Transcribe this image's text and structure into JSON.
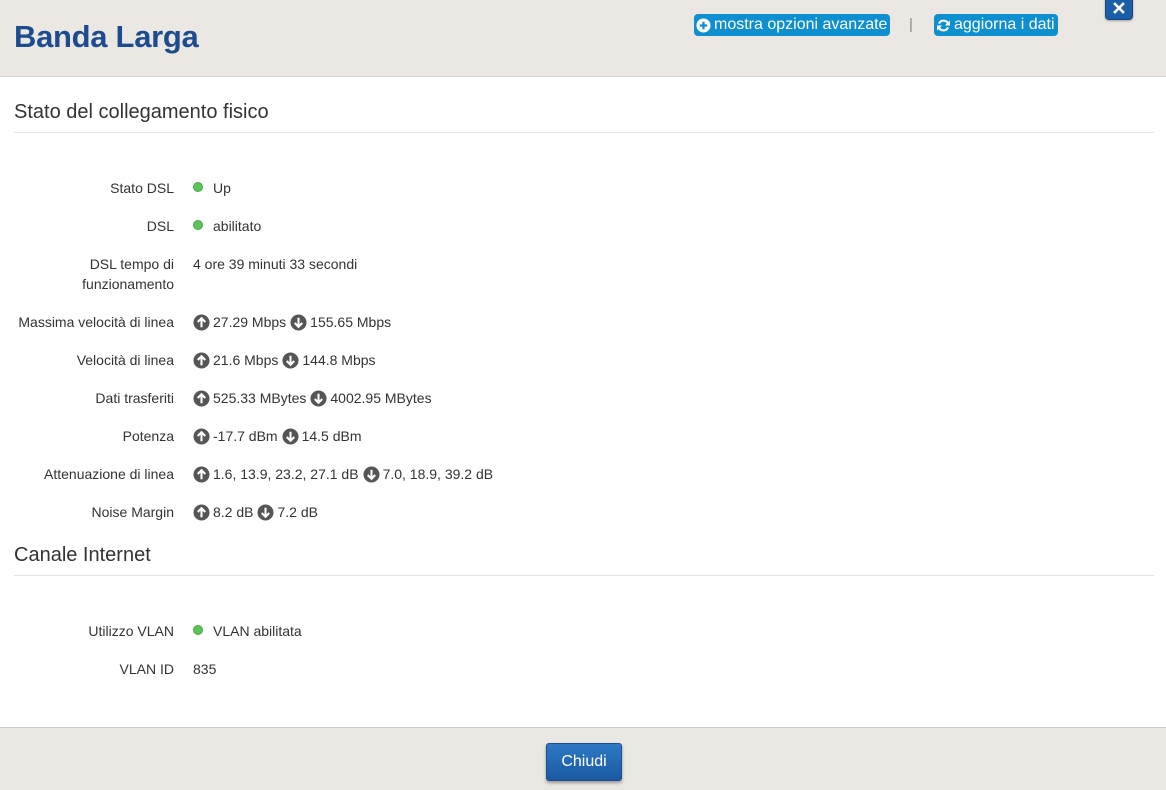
{
  "header": {
    "title": "Banda Larga",
    "advanced_link": "mostra opzioni avanzate",
    "separator": "|",
    "refresh_link": "aggiorna i dati"
  },
  "sections": {
    "physical": {
      "title": "Stato del collegamento fisico"
    },
    "internet": {
      "title": "Canale Internet"
    }
  },
  "rows": {
    "dsl_state": {
      "label": "Stato DSL",
      "value": "Up"
    },
    "dsl": {
      "label": "DSL",
      "value": "abilitato"
    },
    "uptime": {
      "label_line1": "DSL tempo di",
      "label_line2": "funzionamento",
      "value": "4 ore 39 minuti 33 secondi"
    },
    "max_speed": {
      "label": "Massima velocità di linea",
      "up": "27.29 Mbps",
      "down": "155.65 Mbps"
    },
    "line_speed": {
      "label": "Velocità di linea",
      "up": "21.6 Mbps",
      "down": "144.8 Mbps"
    },
    "data": {
      "label": "Dati trasferiti",
      "up": "525.33 MBytes",
      "down": "4002.95 MBytes"
    },
    "power": {
      "label": "Potenza",
      "up": "-17.7 dBm",
      "down": "14.5 dBm"
    },
    "attenuation": {
      "label": "Attenuazione di linea",
      "up": "1.6, 13.9, 23.2, 27.1 dB",
      "down": "7.0, 18.9, 39.2 dB"
    },
    "noise": {
      "label": "Noise Margin",
      "up": "8.2 dB",
      "down": "7.2 dB"
    },
    "vlan_use": {
      "label": "Utilizzo VLAN",
      "value": "VLAN abilitata"
    },
    "vlan_id": {
      "label": "VLAN ID",
      "value": "835"
    }
  },
  "footer": {
    "close_label": "Chiudi"
  },
  "colors": {
    "title": "#1c4b8f",
    "link_bg": "#0e8fd0",
    "status_ok": "#5cc25a",
    "button": "#1a5aa3"
  },
  "icons": {
    "advanced": "plus-circle-icon",
    "refresh": "refresh-icon",
    "close": "close-icon",
    "up": "arrow-up-circle-icon",
    "down": "arrow-down-circle-icon",
    "status": "status-dot-icon"
  }
}
